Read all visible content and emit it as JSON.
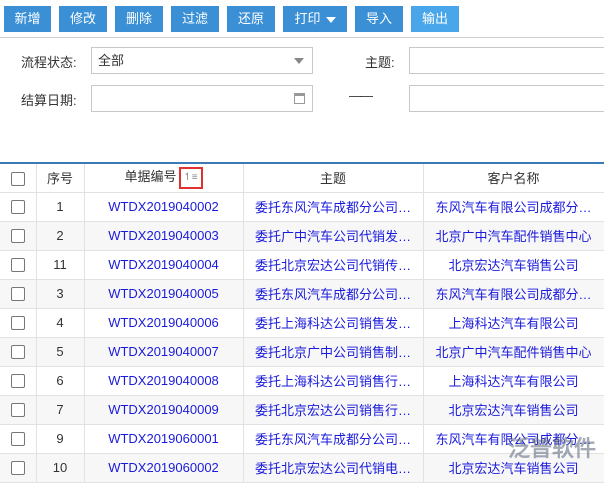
{
  "toolbar": {
    "buttons": [
      "新增",
      "修改",
      "删除",
      "过滤",
      "还原",
      "打印",
      "导入",
      "输出"
    ]
  },
  "filters": {
    "status_label": "流程状态:",
    "status_value": "全部",
    "subject_label": "主题:",
    "subject_value": "",
    "date_label": "结算日期:",
    "date_from": "",
    "date_to": "",
    "range_sep": "——"
  },
  "table": {
    "headers": [
      "序号",
      "单据编号",
      "主题",
      "客户名称"
    ],
    "sort_icon": "↿≡",
    "rows": [
      {
        "seq": "1",
        "code": "WTDX2019040002",
        "subject": "委托东风汽车成都分公司…",
        "customer": "东风汽车有限公司成都分…"
      },
      {
        "seq": "2",
        "code": "WTDX2019040003",
        "subject": "委托广中汽车公司代销发…",
        "customer": "北京广中汽车配件销售中心"
      },
      {
        "seq": "11",
        "code": "WTDX2019040004",
        "subject": "委托北京宏达公司代销传…",
        "customer": "北京宏达汽车销售公司"
      },
      {
        "seq": "3",
        "code": "WTDX2019040005",
        "subject": "委托东风汽车成都分公司…",
        "customer": "东风汽车有限公司成都分…"
      },
      {
        "seq": "4",
        "code": "WTDX2019040006",
        "subject": "委托上海科达公司销售发…",
        "customer": "上海科达汽车有限公司"
      },
      {
        "seq": "5",
        "code": "WTDX2019040007",
        "subject": "委托北京广中公司销售制…",
        "customer": "北京广中汽车配件销售中心"
      },
      {
        "seq": "6",
        "code": "WTDX2019040008",
        "subject": "委托上海科达公司销售行…",
        "customer": "上海科达汽车有限公司"
      },
      {
        "seq": "7",
        "code": "WTDX2019040009",
        "subject": "委托北京宏达公司销售行…",
        "customer": "北京宏达汽车销售公司"
      },
      {
        "seq": "9",
        "code": "WTDX2019060001",
        "subject": "委托东风汽车成都分公司…",
        "customer": "东风汽车有限公司成都分…"
      },
      {
        "seq": "10",
        "code": "WTDX2019060002",
        "subject": "委托北京宏达公司代销电…",
        "customer": "北京宏达汽车销售公司"
      }
    ]
  },
  "watermark": "泛普软件"
}
